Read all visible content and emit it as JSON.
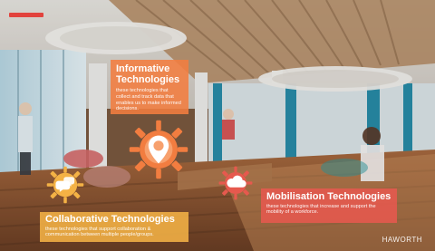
{
  "slide": {
    "logo_text": "HAWORTH",
    "colors": {
      "accent_red": "#e2433d",
      "orange": "#f27d40",
      "yellow": "#f4b245",
      "coral": "#e6594e"
    },
    "cards": {
      "informative": {
        "title_line1": "Informative",
        "title_line2": "Technologies",
        "description": "these technologies that collect and track data that enables us to make informed decisions."
      },
      "collaborative": {
        "title": "Collaborative Technologies",
        "description": "these technologies that support collaboration & communication between multiple people/groups."
      },
      "mobilisation": {
        "title": "Mobilisation Technologies",
        "description": "these technologies that increase and support the mobility of a workforce."
      }
    },
    "icons": {
      "informative": "location-pin-icon",
      "collaborative": "chat-bubbles-icon",
      "mobilisation": "cloud-icon"
    }
  }
}
